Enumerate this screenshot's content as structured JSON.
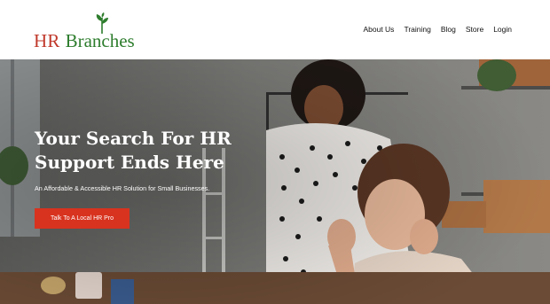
{
  "brand": {
    "hr": "HR",
    "branches": "Branches",
    "hr_color": "#c0392b",
    "branches_color": "#2e7d2e"
  },
  "nav": {
    "items": [
      {
        "label": "About Us"
      },
      {
        "label": "Training"
      },
      {
        "label": "Blog"
      },
      {
        "label": "Store"
      },
      {
        "label": "Login"
      }
    ]
  },
  "hero": {
    "headline_line1": "Your Search For HR",
    "headline_line2": "Support Ends Here",
    "subheadline": "An Affordable & Accessible HR Solution for Small Businesses.",
    "cta_label": "Talk To A Local HR Pro",
    "cta_color": "#d8331f"
  }
}
